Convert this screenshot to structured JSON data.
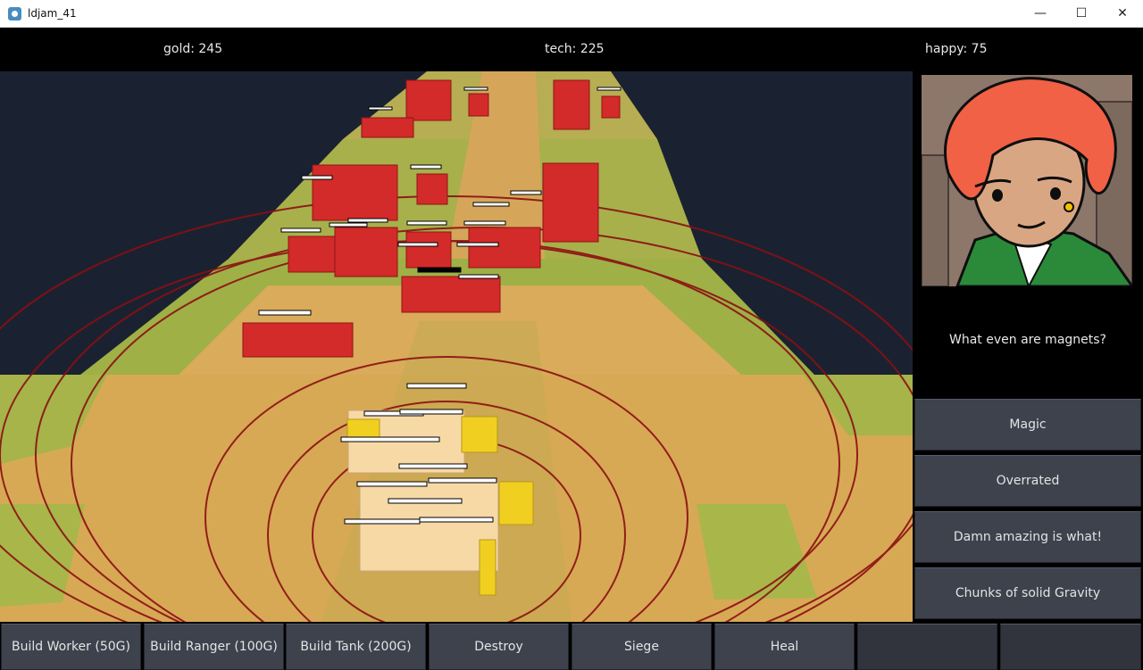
{
  "window": {
    "title": "ldjam_41",
    "min_glyph": "—",
    "max_glyph": "☐",
    "close_glyph": "✕"
  },
  "resources": {
    "gold": "gold: 245",
    "tech": "tech: 225",
    "happy": "happy: 75"
  },
  "colors": {
    "enemy": "#d32a2a",
    "friendly": "#f7d9a6",
    "friendly_accent": "#f0cf20",
    "grass": "#a9b64a",
    "sand": "#d9ab5a",
    "range_ring": "#8b0f12",
    "background": "#1a2231",
    "button": "#3e424d"
  },
  "dialog": {
    "question": "What even are magnets?",
    "choices": [
      {
        "label": "Magic"
      },
      {
        "label": "Overrated"
      },
      {
        "label": "Damn amazing is what!"
      },
      {
        "label": "Chunks of solid Gravity"
      }
    ]
  },
  "actions": [
    {
      "label": "Build Worker (50G)"
    },
    {
      "label": "Build Ranger (100G)"
    },
    {
      "label": "Build Tank (200G)"
    },
    {
      "label": "Destroy"
    },
    {
      "label": "Siege"
    },
    {
      "label": "Heal"
    },
    {
      "label": ""
    },
    {
      "label": ""
    }
  ]
}
